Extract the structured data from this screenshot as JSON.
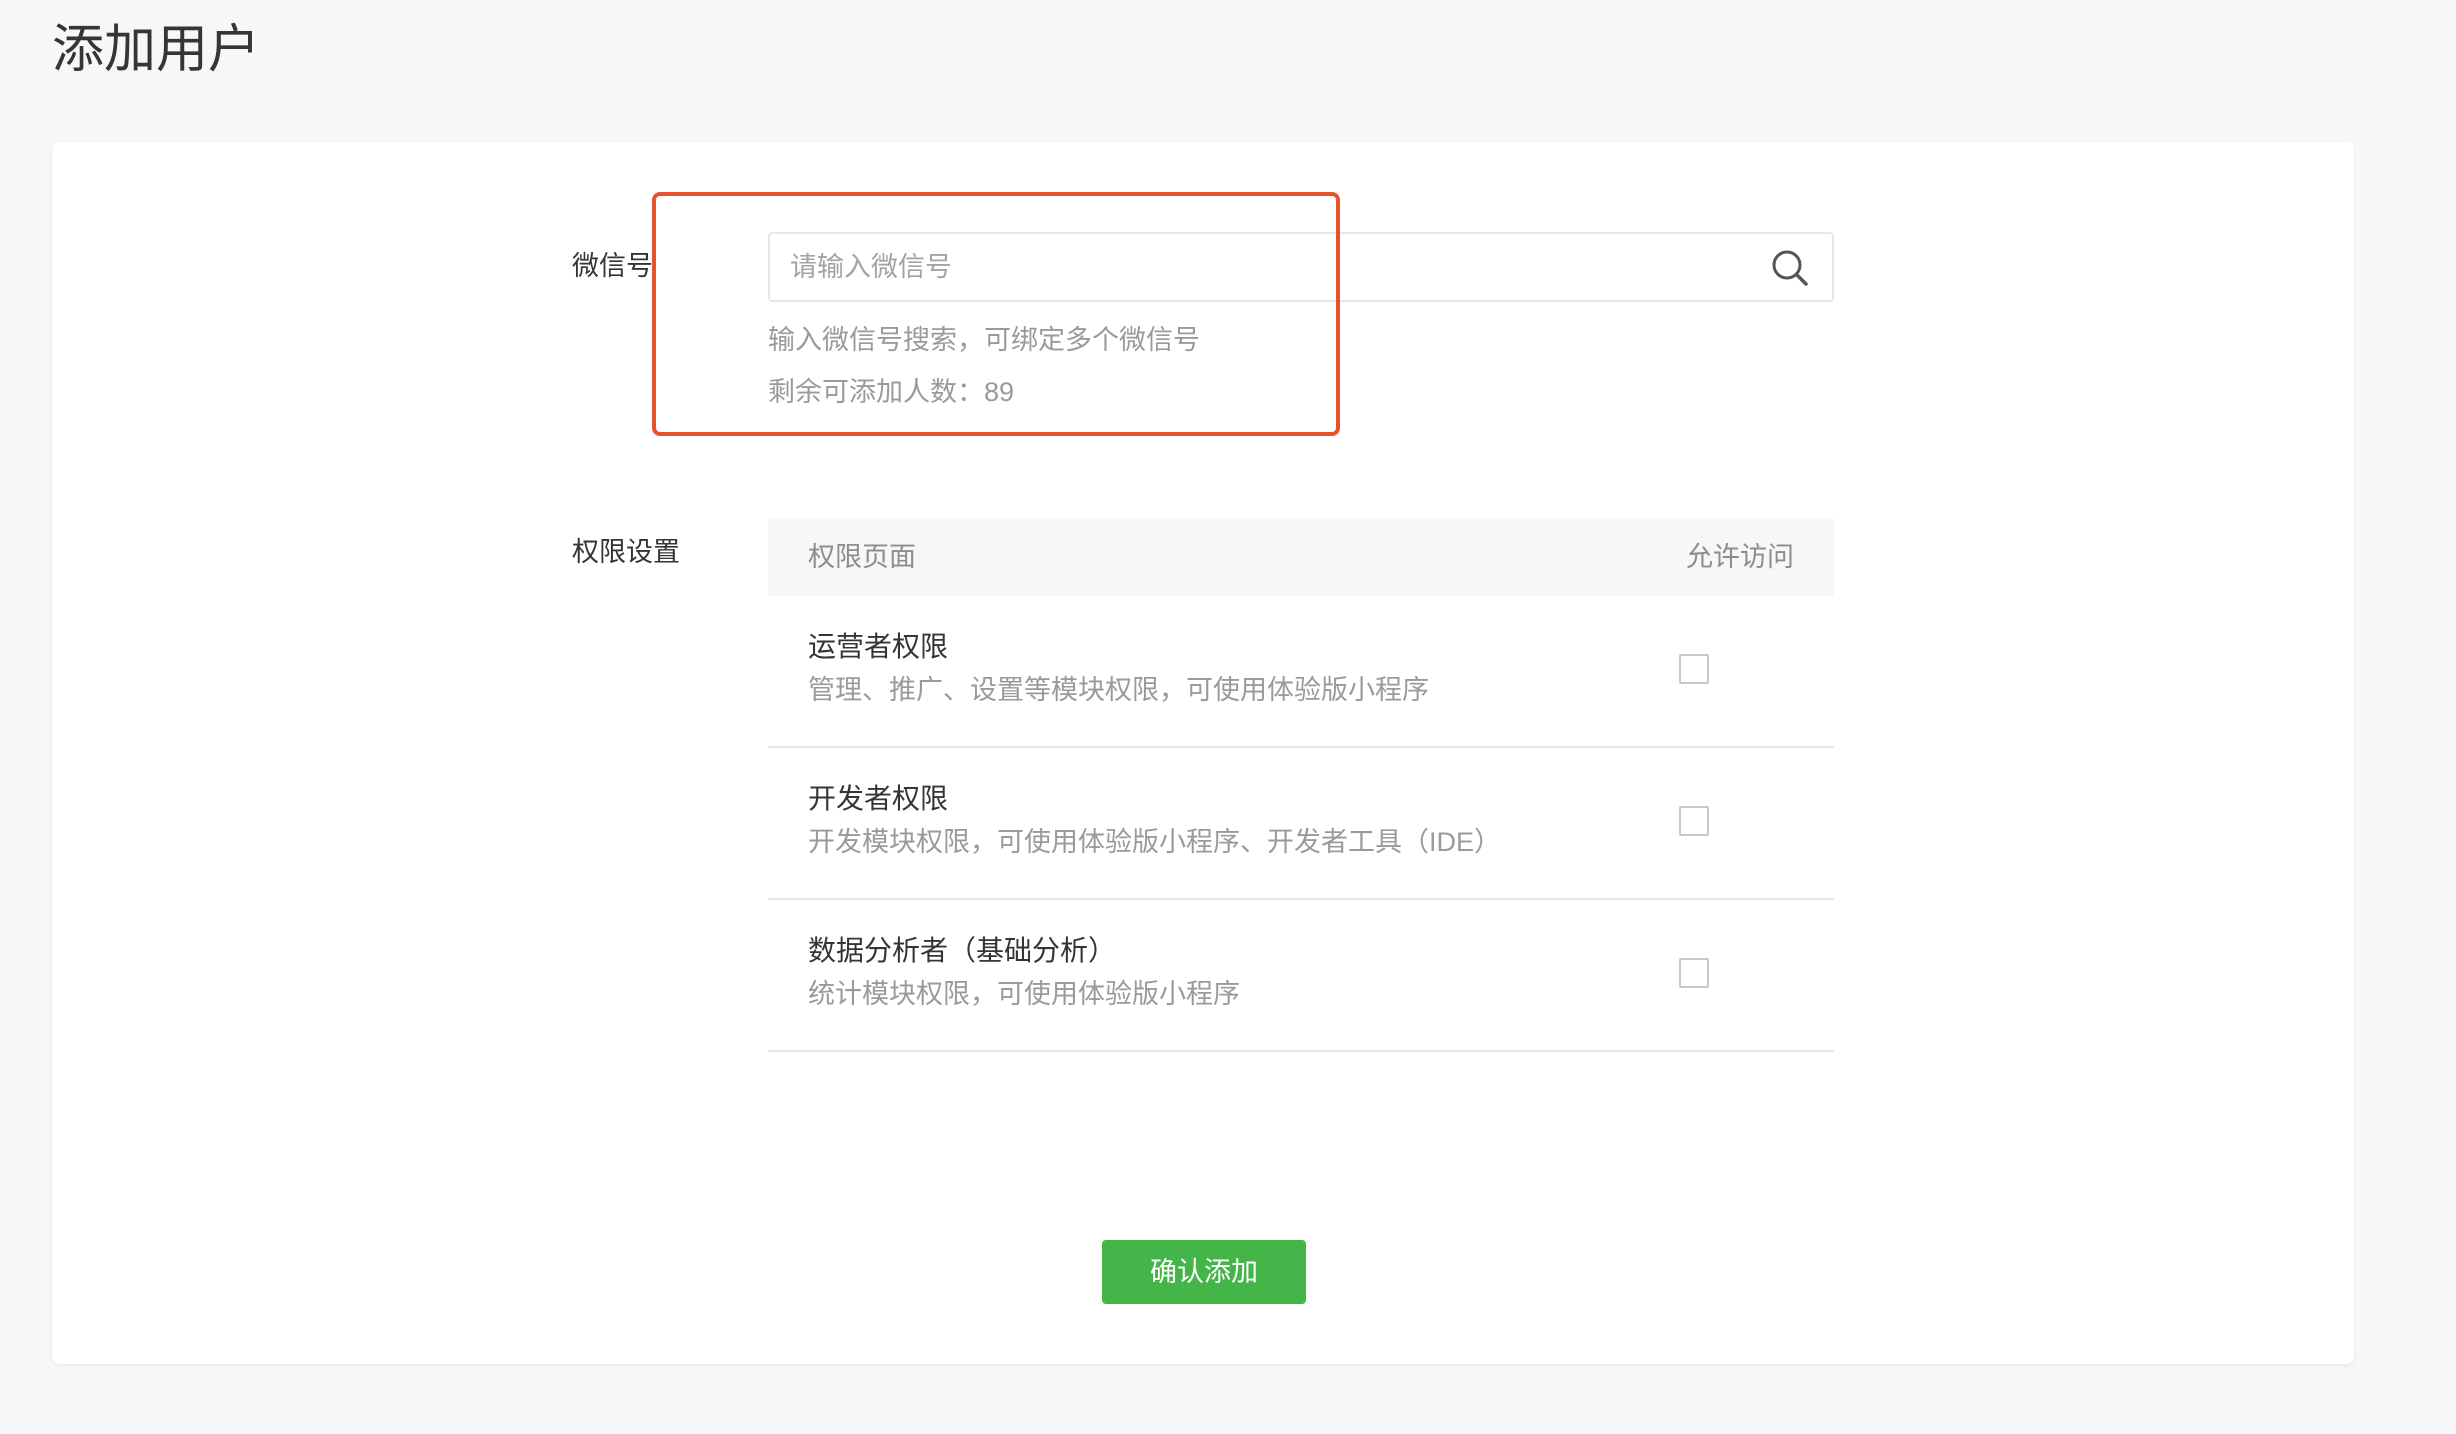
{
  "page": {
    "title": "添加用户"
  },
  "form": {
    "wechat_label": "微信号",
    "search": {
      "placeholder": "请输入微信号",
      "value": "",
      "icon": "search-icon"
    },
    "hint_search": "输入微信号搜索，可绑定多个微信号",
    "hint_remaining": "剩余可添加人数：89",
    "permission_label": "权限设置"
  },
  "permissions": {
    "header": {
      "page_col": "权限页面",
      "allow_col": "允许访问"
    },
    "rows": [
      {
        "title": "运营者权限",
        "desc": "管理、推广、设置等模块权限，可使用体验版小程序",
        "checked": false
      },
      {
        "title": "开发者权限",
        "desc": "开发模块权限，可使用体验版小程序、开发者工具（IDE）",
        "checked": false
      },
      {
        "title": "数据分析者（基础分析）",
        "desc": "统计模块权限，可使用体验版小程序",
        "checked": false
      }
    ]
  },
  "actions": {
    "confirm_label": "确认添加"
  },
  "colors": {
    "accent_green": "#44b549",
    "highlight_red": "#e4532d",
    "background": "#f6f7f8"
  }
}
